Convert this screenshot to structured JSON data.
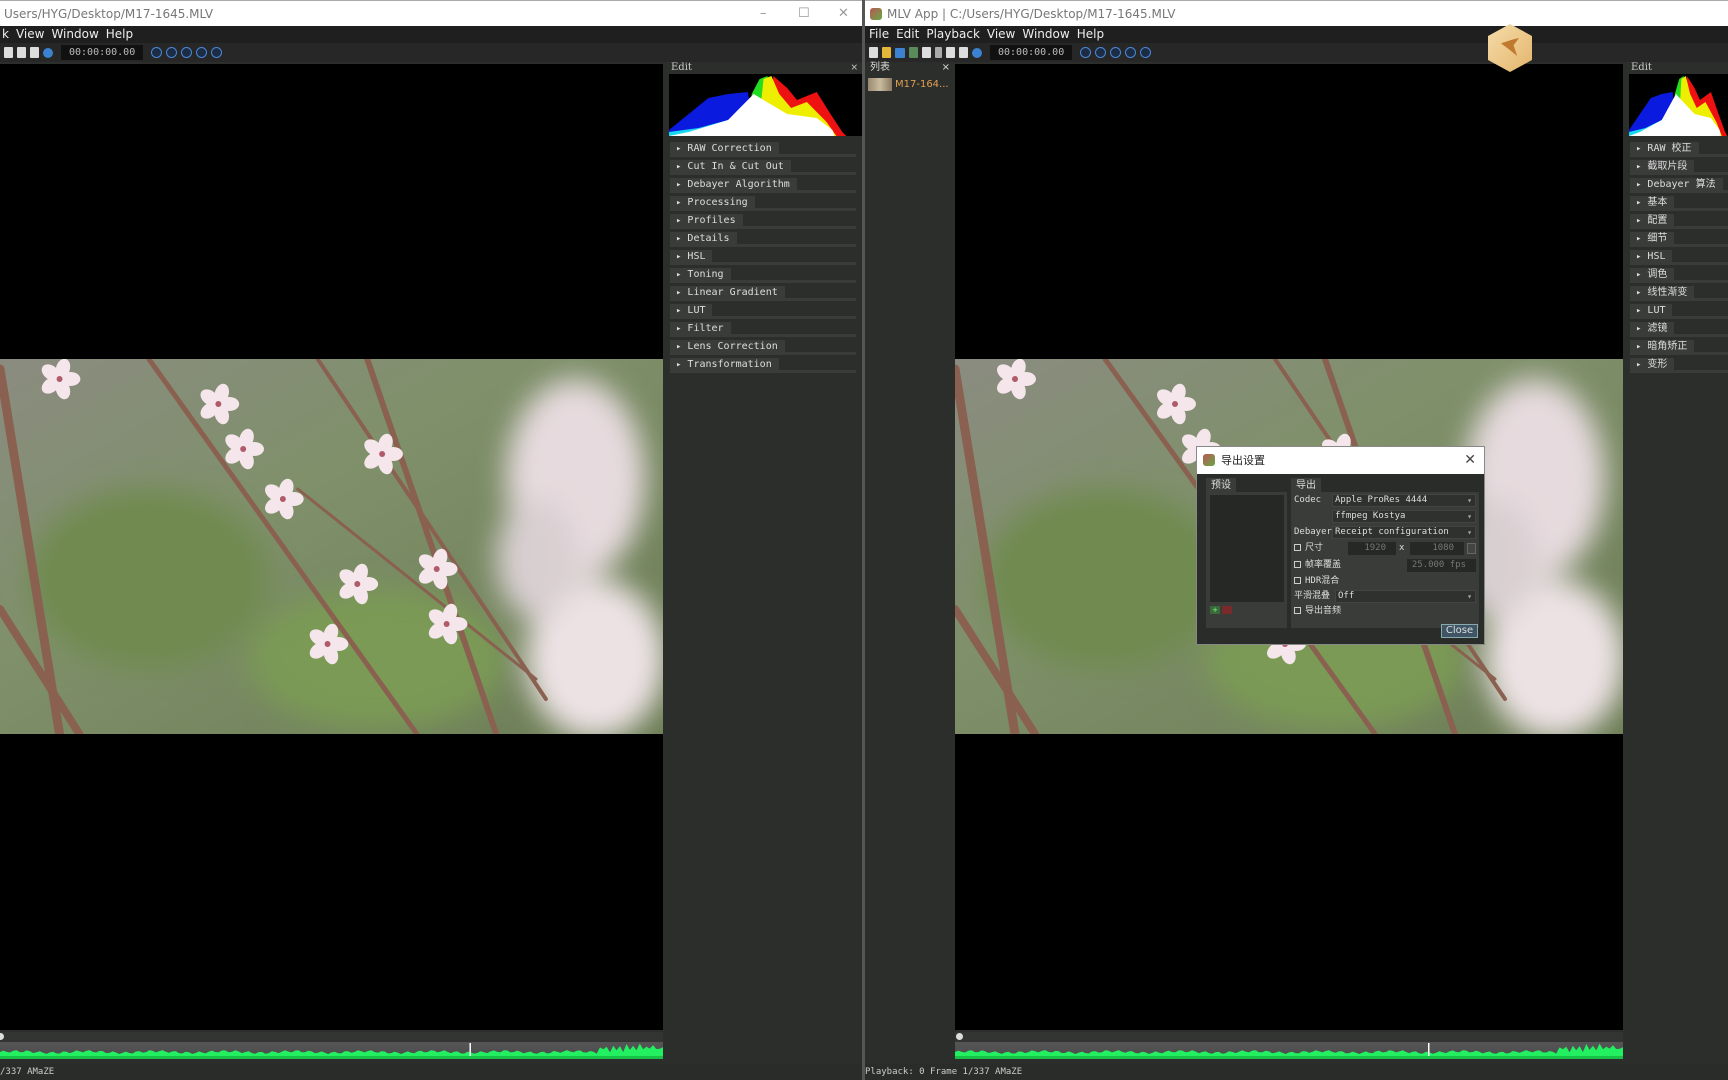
{
  "left": {
    "title": "Users/HYG/Desktop/M17-1645.MLV",
    "menu": [
      "k",
      "View",
      "Window",
      "Help"
    ],
    "timecode": "00:00:00.00",
    "edit_title": "Edit",
    "sections": [
      "RAW Correction",
      "Cut In & Cut Out",
      "Debayer Algorithm",
      "Processing",
      "Profiles",
      "Details",
      "HSL",
      "Toning",
      "Linear Gradient",
      "LUT",
      "Filter",
      "Lens Correction",
      "Transformation"
    ],
    "status": "/337  AMaZE"
  },
  "right": {
    "title": "MLV App | C:/Users/HYG/Desktop/M17-1645.MLV",
    "menu": [
      "File",
      "Edit",
      "Playback",
      "View",
      "Window",
      "Help"
    ],
    "timecode": "00:00:00.00",
    "list_title": "列表",
    "list_item": "M17-164...",
    "edit_title": "Edit",
    "sections": [
      "RAW 校正",
      "截取片段",
      "Debayer 算法",
      "基本",
      "配置",
      "细节",
      "HSL",
      "调色",
      "线性渐变",
      "LUT",
      "滤镜",
      "暗角矫正",
      "变形"
    ],
    "status": "Playback: 0 Frame 1/337  AMaZE"
  },
  "dialog": {
    "title": "导出设置",
    "presets_tab": "预设",
    "export_tab": "导出",
    "codec_label": "Codec",
    "codec_value": "Apple ProRes 4444",
    "codec_option2": "ffmpeg Kostya",
    "debayer_label": "Debayer",
    "debayer_value": "Receipt configuration",
    "size_label": "尺寸",
    "width": "1920",
    "x_sep": "x",
    "height": "1080",
    "fps_label": "帧率覆盖",
    "fps_value": "25.000 fps",
    "hdr_label": "HDR混合",
    "smooth_label": "平滑混叠",
    "smooth_value": "Off",
    "audio_label": "导出音频",
    "close_label": "Close"
  },
  "colors": {
    "accent": "#3b83d1",
    "waveform": "#22f060",
    "list_item": "#e0a050"
  }
}
